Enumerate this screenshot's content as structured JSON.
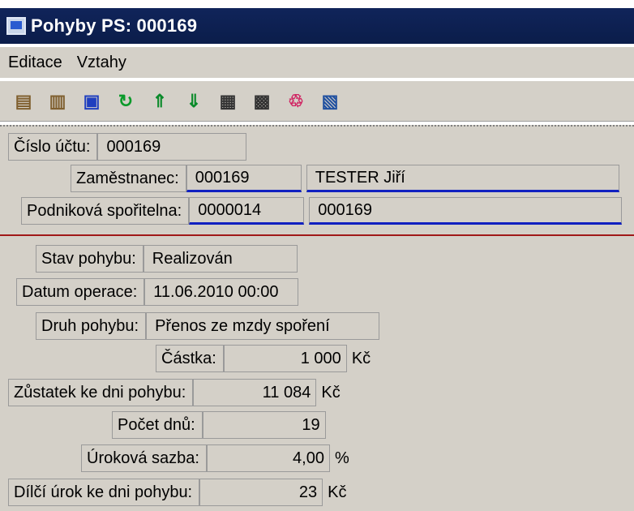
{
  "window": {
    "title": "Pohyby PS: 000169"
  },
  "menu": {
    "items": [
      "Editace",
      "Vztahy"
    ]
  },
  "toolbar": {
    "buttons": [
      {
        "name": "new-icon",
        "glyph": "▤",
        "color": "#806030"
      },
      {
        "name": "copy-icon",
        "glyph": "▥",
        "color": "#806030"
      },
      {
        "name": "save-icon",
        "glyph": "▣",
        "color": "#1f3fbf"
      },
      {
        "name": "refresh-icon",
        "glyph": "↻",
        "color": "#0a9a2a"
      },
      {
        "name": "move-up-icon",
        "glyph": "⇑",
        "color": "#0a8a2a"
      },
      {
        "name": "move-down-icon",
        "glyph": "⇓",
        "color": "#0a8a2a"
      },
      {
        "name": "document-icon",
        "glyph": "▦",
        "color": "#333333"
      },
      {
        "name": "paste-icon",
        "glyph": "▩",
        "color": "#333333"
      },
      {
        "name": "relations-icon",
        "glyph": "♲",
        "color": "#d02060"
      },
      {
        "name": "print-icon",
        "glyph": "▧",
        "color": "#2050a0"
      }
    ]
  },
  "account": {
    "label": "Číslo účtu:",
    "value": "000169"
  },
  "employee": {
    "label": "Zaměstnanec:",
    "code": "000169",
    "name": "TESTER Jiří"
  },
  "savings": {
    "label": "Podniková spořitelna:",
    "code": "0000014",
    "name": "000169"
  },
  "fields": {
    "state": {
      "label": "Stav pohybu:",
      "value": "Realizován"
    },
    "date": {
      "label": "Datum operace:",
      "value": "11.06.2010 00:00"
    },
    "type": {
      "label": "Druh pohybu:",
      "value": "Přenos ze mzdy spoření"
    },
    "amount": {
      "label": "Částka:",
      "value": "1 000",
      "unit": "Kč"
    },
    "balance": {
      "label": "Zůstatek ke dni pohybu:",
      "value": "11 084",
      "unit": "Kč"
    },
    "days": {
      "label": "Počet dnů:",
      "value": "19"
    },
    "rate": {
      "label": "Úroková sazba:",
      "value": "4,00",
      "unit": "%"
    },
    "interest": {
      "label": "Dílčí úrok ke dni pohybu:",
      "value": "23",
      "unit": "Kč"
    }
  },
  "colors": {
    "titlebar": "#0b1d4a",
    "face": "#d4d0c8",
    "link_underline": "#1020c0",
    "divider": "#a01818"
  }
}
